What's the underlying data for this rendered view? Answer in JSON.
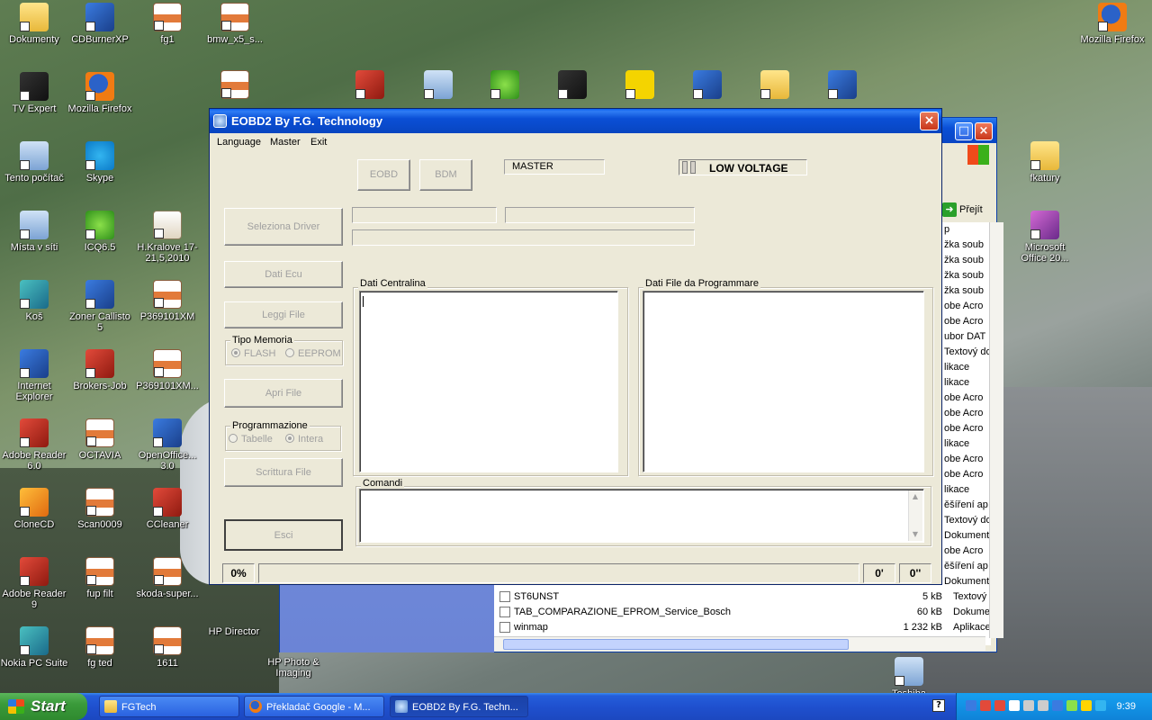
{
  "desktop": {
    "icons": [
      {
        "label": "Dokumenty",
        "icon": "folder-icon"
      },
      {
        "label": "CDBurnerXP",
        "icon": "cd-icon"
      },
      {
        "label": "fg1",
        "icon": "document-icon"
      },
      {
        "label": "bmw_x5_s...",
        "icon": "document-icon"
      },
      {
        "label": "Mozilla Firefox",
        "icon": "firefox-icon"
      },
      {
        "label": "TV Expert",
        "icon": "tv-icon"
      },
      {
        "label": "Mozilla Firefox",
        "icon": "firefox-icon"
      },
      {
        "label": "Tento počítač",
        "icon": "computer-icon"
      },
      {
        "label": "Skype",
        "icon": "skype-icon"
      },
      {
        "label": "fkatury",
        "icon": "folder-icon"
      },
      {
        "label": "Místa v síti",
        "icon": "network-icon"
      },
      {
        "label": "ICQ6.5",
        "icon": "icq-icon"
      },
      {
        "label": "H.Kralove 17-21,5,2010",
        "icon": "spreadsheet-icon"
      },
      {
        "label": "Microsoft Office 20...",
        "icon": "winrar-icon"
      },
      {
        "label": "Koš",
        "icon": "recycle-bin-icon"
      },
      {
        "label": "Zoner Callisto 5",
        "icon": "zoner-icon"
      },
      {
        "label": "P369101XM",
        "icon": "document-icon"
      },
      {
        "label": "Internet Explorer",
        "icon": "ie-icon"
      },
      {
        "label": "Brokers-Job",
        "icon": "app-icon"
      },
      {
        "label": "P369101XM...",
        "icon": "document-icon"
      },
      {
        "label": "Adobe Reader 6.0",
        "icon": "adobe-icon"
      },
      {
        "label": "OCTAVIA",
        "icon": "document-icon"
      },
      {
        "label": "OpenOffice... 3.0",
        "icon": "openoffice-icon"
      },
      {
        "label": "CloneCD",
        "icon": "clonecd-icon"
      },
      {
        "label": "Scan0009",
        "icon": "document-icon"
      },
      {
        "label": "CCleaner",
        "icon": "ccleaner-icon"
      },
      {
        "label": "Adobe Reader 9",
        "icon": "adobe-icon"
      },
      {
        "label": "fup filt",
        "icon": "document-icon"
      },
      {
        "label": "skoda-super...",
        "icon": "document-icon"
      },
      {
        "label": "Nokia PC Suite",
        "icon": "nokia-icon"
      },
      {
        "label": "fg ted",
        "icon": "document-icon"
      },
      {
        "label": "1611",
        "icon": "document-icon"
      },
      {
        "label": "HP Director",
        "icon": "hp-icon"
      },
      {
        "label": "HP Photo & Imaging",
        "icon": "hp-photo-icon"
      },
      {
        "label": "Toshiba Satellite Pro...",
        "icon": "toshiba-icon"
      }
    ]
  },
  "explorer": {
    "go_label": "Přejít",
    "column_fragments": [
      "p",
      "žka soub",
      "žka soub",
      "žka soub",
      "žka soub",
      "obe Acro",
      "obe Acro",
      "ubor DAT",
      "Textový do",
      "likace",
      "likace",
      "obe Acro",
      "obe Acro",
      "obe Acro",
      "likace",
      "obe Acro",
      "obe Acro",
      "likace",
      "ěšíření ap",
      "Textový do",
      "Dokument M",
      "obe Acro",
      "ěšíření ap",
      "Dokument M"
    ],
    "rows": [
      {
        "name": "ST6UNST",
        "size": "5 kB",
        "type": "Textový dok"
      },
      {
        "name": "TAB_COMPARAZIONE_EPROM_Service_Bosch",
        "size": "60 kB",
        "type": "Dokument M"
      },
      {
        "name": "winmap",
        "size": "1 232 kB",
        "type": "Aplikace"
      }
    ]
  },
  "app": {
    "title": "EOBD2 By F.G. Technology",
    "menu": [
      "Language",
      "Master",
      "Exit"
    ],
    "buttons": {
      "eobd": "EOBD",
      "bdm": "BDM",
      "seleziona_driver": "Seleziona Driver",
      "dati_ecu": "Dati Ecu",
      "leggi_file": "Leggi File",
      "apri_file": "Apri File",
      "scrittura_file": "Scrittura File",
      "esci": "Esci"
    },
    "master_field": "MASTER",
    "low_voltage": "LOW VOLTAGE",
    "tipo_memoria": {
      "label": "Tipo Memoria",
      "options": [
        "FLASH",
        "EEPROM"
      ],
      "selected": "FLASH"
    },
    "programmazione": {
      "label": "Programmazione",
      "options": [
        "Tabelle",
        "Intera"
      ],
      "selected": "Intera"
    },
    "groups": {
      "dati_centralina": "Dati Centralina",
      "dati_file": "Dati File da Programmare",
      "comandi": "Comandi"
    },
    "status": {
      "progress": "0%",
      "minutes": "0'",
      "seconds": "0''"
    }
  },
  "taskbar": {
    "start_label": "Start",
    "tasks": [
      {
        "label": "FGTech",
        "icon": "folder-icon"
      },
      {
        "label": "Překladač Google - M...",
        "icon": "firefox-icon"
      },
      {
        "label": "EOBD2 By F.G. Techn...",
        "icon": "app-icon"
      }
    ],
    "clock": "9:39"
  }
}
